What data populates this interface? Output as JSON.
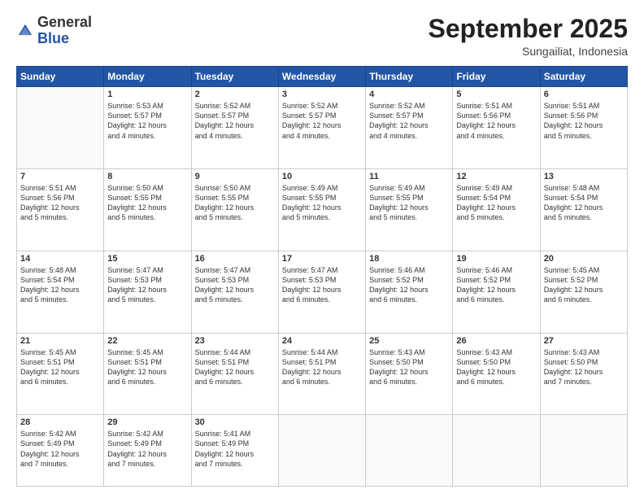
{
  "logo": {
    "general": "General",
    "blue": "Blue"
  },
  "header": {
    "month_title": "September 2025",
    "subtitle": "Sungailiat, Indonesia"
  },
  "weekdays": [
    "Sunday",
    "Monday",
    "Tuesday",
    "Wednesday",
    "Thursday",
    "Friday",
    "Saturday"
  ],
  "weeks": [
    [
      {
        "day": "",
        "info": ""
      },
      {
        "day": "1",
        "info": "Sunrise: 5:53 AM\nSunset: 5:57 PM\nDaylight: 12 hours\nand 4 minutes."
      },
      {
        "day": "2",
        "info": "Sunrise: 5:52 AM\nSunset: 5:57 PM\nDaylight: 12 hours\nand 4 minutes."
      },
      {
        "day": "3",
        "info": "Sunrise: 5:52 AM\nSunset: 5:57 PM\nDaylight: 12 hours\nand 4 minutes."
      },
      {
        "day": "4",
        "info": "Sunrise: 5:52 AM\nSunset: 5:57 PM\nDaylight: 12 hours\nand 4 minutes."
      },
      {
        "day": "5",
        "info": "Sunrise: 5:51 AM\nSunset: 5:56 PM\nDaylight: 12 hours\nand 4 minutes."
      },
      {
        "day": "6",
        "info": "Sunrise: 5:51 AM\nSunset: 5:56 PM\nDaylight: 12 hours\nand 5 minutes."
      }
    ],
    [
      {
        "day": "7",
        "info": "Sunrise: 5:51 AM\nSunset: 5:56 PM\nDaylight: 12 hours\nand 5 minutes."
      },
      {
        "day": "8",
        "info": "Sunrise: 5:50 AM\nSunset: 5:55 PM\nDaylight: 12 hours\nand 5 minutes."
      },
      {
        "day": "9",
        "info": "Sunrise: 5:50 AM\nSunset: 5:55 PM\nDaylight: 12 hours\nand 5 minutes."
      },
      {
        "day": "10",
        "info": "Sunrise: 5:49 AM\nSunset: 5:55 PM\nDaylight: 12 hours\nand 5 minutes."
      },
      {
        "day": "11",
        "info": "Sunrise: 5:49 AM\nSunset: 5:55 PM\nDaylight: 12 hours\nand 5 minutes."
      },
      {
        "day": "12",
        "info": "Sunrise: 5:49 AM\nSunset: 5:54 PM\nDaylight: 12 hours\nand 5 minutes."
      },
      {
        "day": "13",
        "info": "Sunrise: 5:48 AM\nSunset: 5:54 PM\nDaylight: 12 hours\nand 5 minutes."
      }
    ],
    [
      {
        "day": "14",
        "info": "Sunrise: 5:48 AM\nSunset: 5:54 PM\nDaylight: 12 hours\nand 5 minutes."
      },
      {
        "day": "15",
        "info": "Sunrise: 5:47 AM\nSunset: 5:53 PM\nDaylight: 12 hours\nand 5 minutes."
      },
      {
        "day": "16",
        "info": "Sunrise: 5:47 AM\nSunset: 5:53 PM\nDaylight: 12 hours\nand 5 minutes."
      },
      {
        "day": "17",
        "info": "Sunrise: 5:47 AM\nSunset: 5:53 PM\nDaylight: 12 hours\nand 6 minutes."
      },
      {
        "day": "18",
        "info": "Sunrise: 5:46 AM\nSunset: 5:52 PM\nDaylight: 12 hours\nand 6 minutes."
      },
      {
        "day": "19",
        "info": "Sunrise: 5:46 AM\nSunset: 5:52 PM\nDaylight: 12 hours\nand 6 minutes."
      },
      {
        "day": "20",
        "info": "Sunrise: 5:45 AM\nSunset: 5:52 PM\nDaylight: 12 hours\nand 6 minutes."
      }
    ],
    [
      {
        "day": "21",
        "info": "Sunrise: 5:45 AM\nSunset: 5:51 PM\nDaylight: 12 hours\nand 6 minutes."
      },
      {
        "day": "22",
        "info": "Sunrise: 5:45 AM\nSunset: 5:51 PM\nDaylight: 12 hours\nand 6 minutes."
      },
      {
        "day": "23",
        "info": "Sunrise: 5:44 AM\nSunset: 5:51 PM\nDaylight: 12 hours\nand 6 minutes."
      },
      {
        "day": "24",
        "info": "Sunrise: 5:44 AM\nSunset: 5:51 PM\nDaylight: 12 hours\nand 6 minutes."
      },
      {
        "day": "25",
        "info": "Sunrise: 5:43 AM\nSunset: 5:50 PM\nDaylight: 12 hours\nand 6 minutes."
      },
      {
        "day": "26",
        "info": "Sunrise: 5:43 AM\nSunset: 5:50 PM\nDaylight: 12 hours\nand 6 minutes."
      },
      {
        "day": "27",
        "info": "Sunrise: 5:43 AM\nSunset: 5:50 PM\nDaylight: 12 hours\nand 7 minutes."
      }
    ],
    [
      {
        "day": "28",
        "info": "Sunrise: 5:42 AM\nSunset: 5:49 PM\nDaylight: 12 hours\nand 7 minutes."
      },
      {
        "day": "29",
        "info": "Sunrise: 5:42 AM\nSunset: 5:49 PM\nDaylight: 12 hours\nand 7 minutes."
      },
      {
        "day": "30",
        "info": "Sunrise: 5:41 AM\nSunset: 5:49 PM\nDaylight: 12 hours\nand 7 minutes."
      },
      {
        "day": "",
        "info": ""
      },
      {
        "day": "",
        "info": ""
      },
      {
        "day": "",
        "info": ""
      },
      {
        "day": "",
        "info": ""
      }
    ]
  ]
}
